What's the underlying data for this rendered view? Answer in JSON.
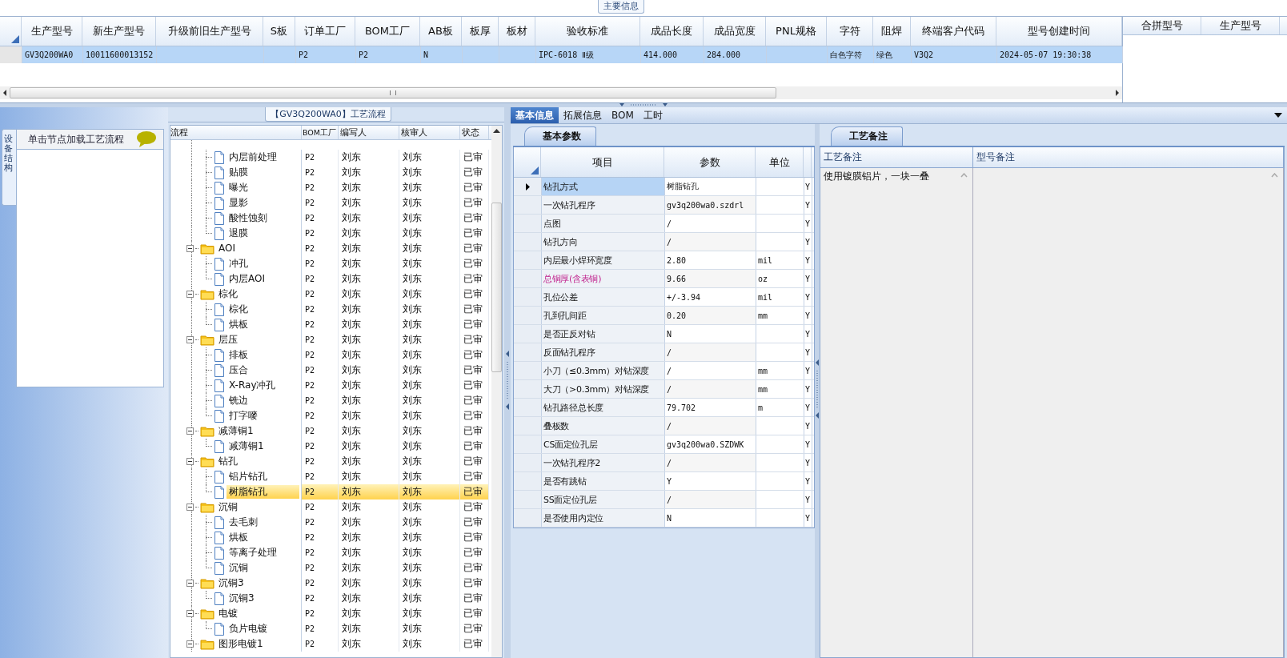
{
  "main_info": {
    "title": "主要信息",
    "columns": [
      "生产型号",
      "新生产型号",
      "升级前旧生产型号",
      "S板",
      "订单工厂",
      "BOM工厂",
      "AB板",
      "板厚",
      "板材",
      "验收标准",
      "成品长度",
      "成品宽度",
      "PNL规格",
      "字符",
      "阻焊",
      "终端客户代码",
      "型号创建时间"
    ],
    "rows": [
      {
        "selected": true,
        "cells": [
          "GV3Q200WA0",
          "10011600013152",
          null,
          null,
          "P2",
          "P2",
          "N",
          null,
          null,
          "IPC-6018 Ⅱ级",
          "414.000",
          "284.000",
          null,
          "白色字符",
          "绿色",
          "V3Q2",
          "2024-05-07 19:30:38"
        ]
      }
    ]
  },
  "merge_grid": {
    "columns": [
      "合拼型号",
      "生产型号"
    ]
  },
  "side_tab": "设备结构",
  "hint_panel": {
    "text": "单击节点加载工艺流程"
  },
  "flow": {
    "title": "【GV3Q200WA0】工艺流程",
    "columns": [
      "流程",
      "BOM工厂",
      "编写人",
      "核审人",
      "状态"
    ],
    "nodes": [
      {
        "children": [
          {
            "name": "内层前处理",
            "bom": "P2",
            "writer": "刘东",
            "reviewer": "刘东",
            "status": "已审",
            "selected": false
          },
          {
            "name": "贴膜",
            "bom": "P2",
            "writer": "刘东",
            "reviewer": "刘东",
            "status": "已审",
            "selected": false
          },
          {
            "name": "曝光",
            "bom": "P2",
            "writer": "刘东",
            "reviewer": "刘东",
            "status": "已审",
            "selected": false
          },
          {
            "name": "显影",
            "bom": "P2",
            "writer": "刘东",
            "reviewer": "刘东",
            "status": "已审",
            "selected": false
          },
          {
            "name": "酸性蚀刻",
            "bom": "P2",
            "writer": "刘东",
            "reviewer": "刘东",
            "status": "已审",
            "selected": false
          },
          {
            "name": "退膜",
            "bom": "P2",
            "writer": "刘东",
            "reviewer": "刘东",
            "status": "已审",
            "selected": false
          }
        ]
      },
      {
        "name": "AOI",
        "bom": "P2",
        "writer": "刘东",
        "reviewer": "刘东",
        "status": "已审",
        "expanded": true,
        "selected": false,
        "children": [
          {
            "name": "冲孔",
            "bom": "P2",
            "writer": "刘东",
            "reviewer": "刘东",
            "status": "已审",
            "selected": false
          },
          {
            "name": "内层AOI",
            "bom": "P2",
            "writer": "刘东",
            "reviewer": "刘东",
            "status": "已审",
            "selected": false
          }
        ]
      },
      {
        "name": "棕化",
        "bom": "P2",
        "writer": "刘东",
        "reviewer": "刘东",
        "status": "已审",
        "expanded": true,
        "selected": false,
        "children": [
          {
            "name": "棕化",
            "bom": "P2",
            "writer": "刘东",
            "reviewer": "刘东",
            "status": "已审",
            "selected": false
          },
          {
            "name": "烘板",
            "bom": "P2",
            "writer": "刘东",
            "reviewer": "刘东",
            "status": "已审",
            "selected": false
          }
        ]
      },
      {
        "name": "层压",
        "bom": "P2",
        "writer": "刘东",
        "reviewer": "刘东",
        "status": "已审",
        "expanded": true,
        "selected": false,
        "children": [
          {
            "name": "排板",
            "bom": "P2",
            "writer": "刘东",
            "reviewer": "刘东",
            "status": "已审",
            "selected": false
          },
          {
            "name": "压合",
            "bom": "P2",
            "writer": "刘东",
            "reviewer": "刘东",
            "status": "已审",
            "selected": false
          },
          {
            "name": "X-Ray冲孔",
            "bom": "P2",
            "writer": "刘东",
            "reviewer": "刘东",
            "status": "已审",
            "selected": false
          },
          {
            "name": "铣边",
            "bom": "P2",
            "writer": "刘东",
            "reviewer": "刘东",
            "status": "已审",
            "selected": false
          },
          {
            "name": "打字嘜",
            "bom": "P2",
            "writer": "刘东",
            "reviewer": "刘东",
            "status": "已审",
            "selected": false
          }
        ]
      },
      {
        "name": "减薄铜1",
        "bom": "P2",
        "writer": "刘东",
        "reviewer": "刘东",
        "status": "已审",
        "expanded": true,
        "selected": false,
        "children": [
          {
            "name": "减薄铜1",
            "bom": "P2",
            "writer": "刘东",
            "reviewer": "刘东",
            "status": "已审",
            "selected": false
          }
        ]
      },
      {
        "name": "钻孔",
        "bom": "P2",
        "writer": "刘东",
        "reviewer": "刘东",
        "status": "已审",
        "expanded": true,
        "selected": false,
        "children": [
          {
            "name": "铝片钻孔",
            "bom": "P2",
            "writer": "刘东",
            "reviewer": "刘东",
            "status": "已审",
            "selected": false
          },
          {
            "name": "树脂钻孔",
            "bom": "P2",
            "writer": "刘东",
            "reviewer": "刘东",
            "status": "已审",
            "selected": true
          }
        ]
      },
      {
        "name": "沉铜",
        "bom": "P2",
        "writer": "刘东",
        "reviewer": "刘东",
        "status": "已审",
        "expanded": true,
        "selected": false,
        "children": [
          {
            "name": "去毛刺",
            "bom": "P2",
            "writer": "刘东",
            "reviewer": "刘东",
            "status": "已审",
            "selected": false
          },
          {
            "name": "烘板",
            "bom": "P2",
            "writer": "刘东",
            "reviewer": "刘东",
            "status": "已审",
            "selected": false
          },
          {
            "name": "等离子处理",
            "bom": "P2",
            "writer": "刘东",
            "reviewer": "刘东",
            "status": "已审",
            "selected": false
          },
          {
            "name": "沉铜",
            "bom": "P2",
            "writer": "刘东",
            "reviewer": "刘东",
            "status": "已审",
            "selected": false
          }
        ]
      },
      {
        "name": "沉铜3",
        "bom": "P2",
        "writer": "刘东",
        "reviewer": "刘东",
        "status": "已审",
        "expanded": true,
        "selected": false,
        "children": [
          {
            "name": "沉铜3",
            "bom": "P2",
            "writer": "刘东",
            "reviewer": "刘东",
            "status": "已审",
            "selected": false
          }
        ]
      },
      {
        "name": "电镀",
        "bom": "P2",
        "writer": "刘东",
        "reviewer": "刘东",
        "status": "已审",
        "expanded": true,
        "selected": false,
        "children": [
          {
            "name": "负片电镀",
            "bom": "P2",
            "writer": "刘东",
            "reviewer": "刘东",
            "status": "已审",
            "selected": false
          }
        ]
      },
      {
        "name": "图形电镀1",
        "bom": "P2",
        "writer": "刘东",
        "reviewer": "刘东",
        "status": "已审",
        "expanded": true,
        "selected": false
      }
    ]
  },
  "tabs": [
    {
      "label": "基本信息",
      "selected": true
    },
    {
      "label": "拓展信息",
      "selected": false
    },
    {
      "label": "BOM",
      "selected": false
    },
    {
      "label": "工时",
      "selected": false
    }
  ],
  "sub_tab": "基本参数",
  "params": {
    "columns": [
      "项目",
      "参数",
      "单位"
    ],
    "rows": [
      {
        "item": "钻孔方式",
        "value": "树脂钻孔",
        "unit": null,
        "flag": "Y",
        "current": true,
        "highlight": false
      },
      {
        "item": "一次钻孔程序",
        "value": "gv3q200wa0.szdrl",
        "unit": null,
        "flag": "Y",
        "current": false,
        "highlight": false
      },
      {
        "item": "点图",
        "value": "/",
        "unit": null,
        "flag": "Y",
        "current": false,
        "highlight": false
      },
      {
        "item": "钻孔方向",
        "value": "/",
        "unit": null,
        "flag": "Y",
        "current": false,
        "highlight": false
      },
      {
        "item": "内层最小焊环宽度",
        "value": "2.80",
        "unit": "mil",
        "flag": "Y",
        "current": false,
        "highlight": false
      },
      {
        "item": "总铜厚(含表铜)",
        "value": "9.66",
        "unit": "oz",
        "flag": "Y",
        "current": false,
        "highlight": true
      },
      {
        "item": "孔位公差",
        "value": "+/-3.94",
        "unit": "mil",
        "flag": "Y",
        "current": false,
        "highlight": false
      },
      {
        "item": "孔到孔间距",
        "value": "0.20",
        "unit": "mm",
        "flag": "Y",
        "current": false,
        "highlight": false
      },
      {
        "item": "是否正反对钻",
        "value": "N",
        "unit": null,
        "flag": "Y",
        "current": false,
        "highlight": false
      },
      {
        "item": "反面钻孔程序",
        "value": "/",
        "unit": null,
        "flag": "Y",
        "current": false,
        "highlight": false
      },
      {
        "item": "小刀（≤0.3mm）对钻深度",
        "value": "/",
        "unit": "mm",
        "flag": "Y",
        "current": false,
        "highlight": false
      },
      {
        "item": "大刀（>0.3mm）对钻深度",
        "value": "/",
        "unit": "mm",
        "flag": "Y",
        "current": false,
        "highlight": false
      },
      {
        "item": "钻孔路径总长度",
        "value": "79.702",
        "unit": "m",
        "flag": "Y",
        "current": false,
        "highlight": false
      },
      {
        "item": "叠板数",
        "value": "/",
        "unit": null,
        "flag": "Y",
        "current": false,
        "highlight": false
      },
      {
        "item": "CS面定位孔层",
        "value": "gv3q200wa0.SZDWK",
        "unit": null,
        "flag": "Y",
        "current": false,
        "highlight": false
      },
      {
        "item": "一次钻孔程序2",
        "value": "/",
        "unit": null,
        "flag": "Y",
        "current": false,
        "highlight": false
      },
      {
        "item": "是否有跳钻",
        "value": "Y",
        "unit": null,
        "flag": "Y",
        "current": false,
        "highlight": false
      },
      {
        "item": "SS面定位孔层",
        "value": "/",
        "unit": null,
        "flag": "Y",
        "current": false,
        "highlight": false
      },
      {
        "item": "是否使用内定位",
        "value": "N",
        "unit": null,
        "flag": "Y",
        "current": false,
        "highlight": false
      }
    ]
  },
  "notes": {
    "tab": "工艺备注",
    "columns": [
      "工艺备注",
      "型号备注"
    ],
    "process_note": "使用镀膜铝片，一块一叠"
  }
}
